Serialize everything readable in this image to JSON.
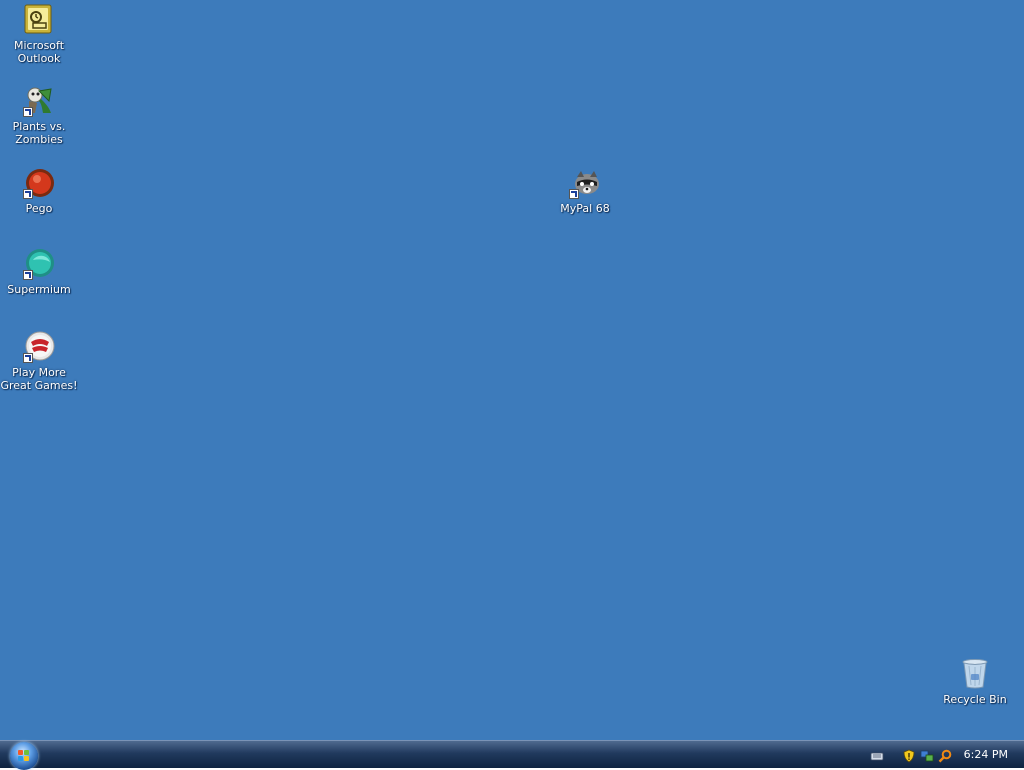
{
  "desktop": {
    "background_color": "#3d7bbb",
    "icons": [
      {
        "name": "microsoft-outlook",
        "label": "Microsoft\nOutlook",
        "icon": "outlook-icon"
      },
      {
        "name": "plants-vs-zombies",
        "label": "Plants vs.\nZombies",
        "icon": "plants-vs-zombies-icon"
      },
      {
        "name": "pego",
        "label": "Pego",
        "icon": "pego-icon"
      },
      {
        "name": "supermium",
        "label": "Supermium",
        "icon": "supermium-icon"
      },
      {
        "name": "play-more-great-games",
        "label": "Play More\nGreat Games!",
        "icon": "popcap-icon"
      },
      {
        "name": "mypal-68",
        "label": "MyPal 68",
        "icon": "mypal-raccoon-icon"
      },
      {
        "name": "recycle-bin",
        "label": "Recycle Bin",
        "icon": "recycle-bin-icon"
      }
    ]
  },
  "taskbar": {
    "start_icon": "windows-start-orb",
    "tray_icons": [
      "keyboard-icon",
      "security-shield-icon",
      "network-icon",
      "search-icon"
    ],
    "clock": "6:24 PM"
  }
}
